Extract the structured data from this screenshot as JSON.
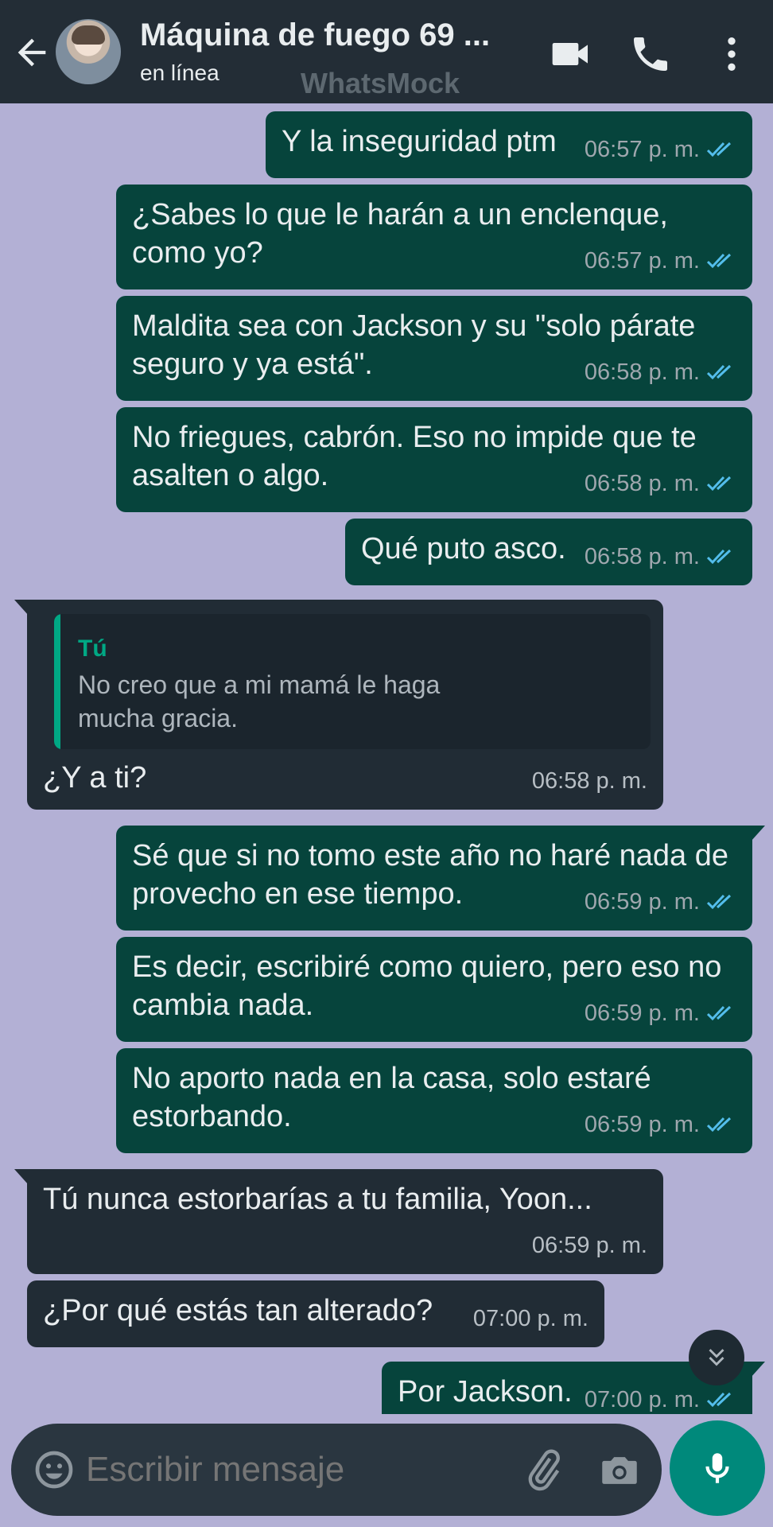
{
  "header": {
    "contact_name": "Máquina de fuego 69 ...",
    "status": "en línea",
    "watermark": "WhatsMock"
  },
  "messages": [
    {
      "dir": "out",
      "text": "Y la inseguridad ptm",
      "time": "06:57 p. m."
    },
    {
      "dir": "out",
      "text": "¿Sabes lo que le harán a un enclenque, como yo?",
      "time": "06:57 p. m."
    },
    {
      "dir": "out",
      "text": "Maldita sea con Jackson y su \"solo párate seguro y ya está\".",
      "time": "06:58 p. m."
    },
    {
      "dir": "out",
      "text": "No friegues, cabrón. Eso no impide que te asalten o algo.",
      "time": "06:58 p. m."
    },
    {
      "dir": "out",
      "text": "Qué puto asco.",
      "time": "06:58 p. m."
    },
    {
      "dir": "in",
      "quote_author": "Tú",
      "quote_text": "No creo que a mi mamá le haga mucha gracia.",
      "text": "¿Y a ti?",
      "time": "06:58 p. m."
    },
    {
      "dir": "out",
      "text": "Sé que si no tomo este año no haré nada de provecho en ese tiempo.",
      "time": "06:59 p. m."
    },
    {
      "dir": "out",
      "text": "Es decir, escribiré como quiero, pero eso no cambia nada.",
      "time": "06:59 p. m."
    },
    {
      "dir": "out",
      "text": "No aporto nada en la casa, solo estaré estorbando.",
      "time": "06:59 p. m."
    },
    {
      "dir": "in",
      "text": "Tú nunca estorbarías a tu familia, Yoon...",
      "time": "06:59 p. m."
    },
    {
      "dir": "in",
      "text": "¿Por qué estás tan alterado?",
      "time": "07:00 p. m."
    },
    {
      "dir": "out",
      "text": "Por Jackson.",
      "time": "07:00 p. m."
    }
  ],
  "input": {
    "placeholder": "Escribir mensaje"
  },
  "icons": {
    "back": "arrow-left-icon",
    "video": "video-camera-icon",
    "call": "phone-icon",
    "menu": "more-vert-icon",
    "emoji": "emoji-icon",
    "attach": "paperclip-icon",
    "camera": "camera-icon",
    "mic": "microphone-icon",
    "scroll": "double-chevron-down-icon",
    "ticks": "double-check-icon"
  },
  "colors": {
    "chat_bg": "#b3b0d5",
    "header_bg": "#232d36",
    "outgoing_bubble": "#06443c",
    "incoming_bubble": "#212c35",
    "read_ticks": "#53bdeb",
    "accent": "#00a884",
    "mic_button": "#00897b"
  }
}
